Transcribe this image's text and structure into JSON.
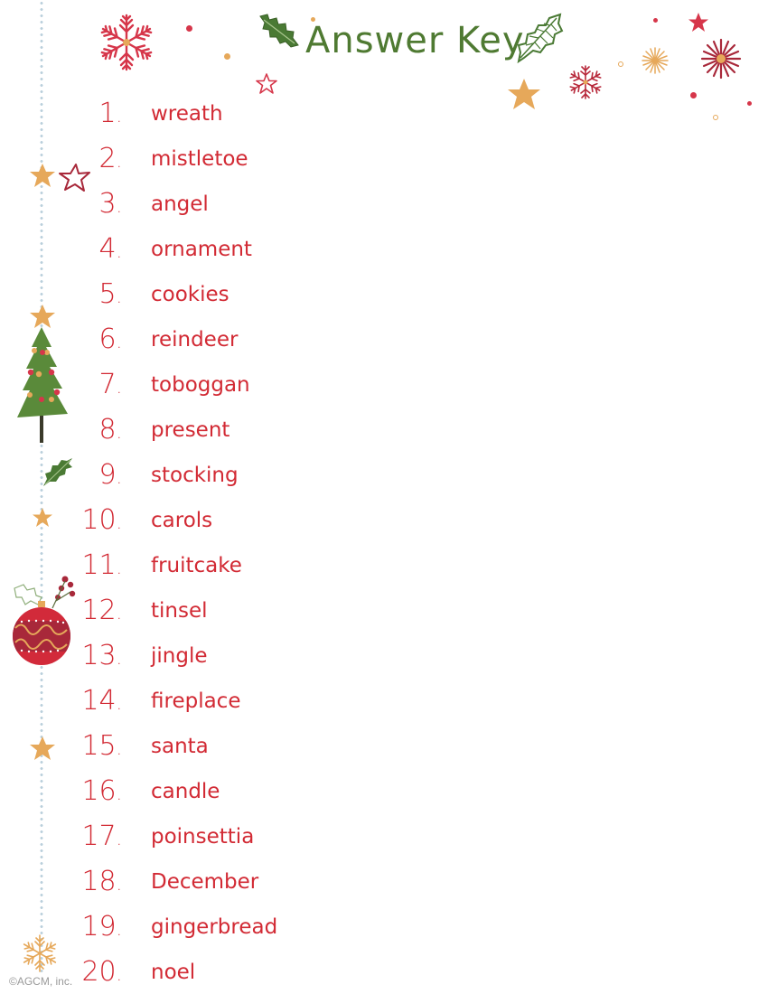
{
  "page": {
    "title": "Answer Key",
    "copyright": "©AGCM, inc."
  },
  "colors": {
    "text_red": "#d22a34",
    "title_green": "#4f7a32",
    "star_gold": "#e6a85a",
    "holly_green": "#4a7a34",
    "dotted_line_blue": "#b9cfdb"
  },
  "answers": [
    {
      "number": "1",
      "word": "wreath"
    },
    {
      "number": "2",
      "word": "mistletoe"
    },
    {
      "number": "3",
      "word": "angel"
    },
    {
      "number": "4",
      "word": "ornament"
    },
    {
      "number": "5",
      "word": "cookies"
    },
    {
      "number": "6",
      "word": "reindeer"
    },
    {
      "number": "7",
      "word": "toboggan"
    },
    {
      "number": "8",
      "word": "present"
    },
    {
      "number": "9",
      "word": "stocking"
    },
    {
      "number": "10",
      "word": "carols"
    },
    {
      "number": "11",
      "word": "fruitcake"
    },
    {
      "number": "12",
      "word": "tinsel"
    },
    {
      "number": "13",
      "word": "jingle"
    },
    {
      "number": "14",
      "word": "fireplace"
    },
    {
      "number": "15",
      "word": "santa"
    },
    {
      "number": "16",
      "word": "candle"
    },
    {
      "number": "17",
      "word": "poinsettia"
    },
    {
      "number": "18",
      "word": "December"
    },
    {
      "number": "19",
      "word": "gingerbread"
    },
    {
      "number": "20",
      "word": "noel"
    }
  ],
  "decorations": {
    "icons": [
      "snowflake-icon",
      "holly-leaf-icon",
      "star-icon",
      "christmas-tree-icon",
      "ornament-bauble-icon",
      "starburst-icon"
    ]
  }
}
